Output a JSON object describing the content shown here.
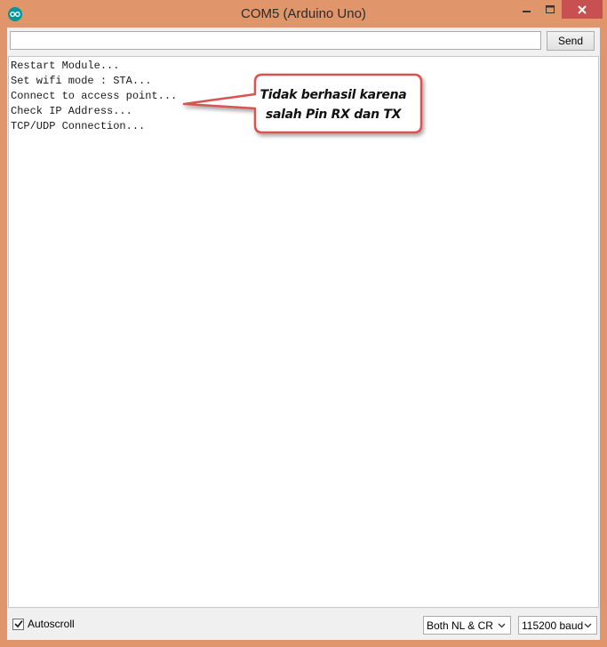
{
  "window": {
    "title": "COM5 (Arduino Uno)"
  },
  "input": {
    "value": "",
    "placeholder": ""
  },
  "send_button": {
    "label": "Send"
  },
  "output_lines": [
    "Restart Module...",
    "Set wifi mode : STA...",
    "Connect to access point...",
    "Check IP Address...",
    "TCP/UDP Connection..."
  ],
  "annotation": {
    "line1": "Tidak berhasil karena",
    "line2": "salah Pin RX dan TX"
  },
  "footer": {
    "autoscroll_label": "Autoscroll",
    "autoscroll_checked": true,
    "line_ending": "Both NL & CR",
    "baud_rate": "115200 baud"
  },
  "colors": {
    "window_frame": "#e0956b",
    "close_button": "#c75050",
    "annotation_border": "#d9534f",
    "app_icon": "#00979c"
  },
  "icons": {
    "app": "arduino-logo-icon",
    "minimize": "minimize-icon",
    "maximize": "maximize-icon",
    "close": "close-icon",
    "checkbox": "checkmark-icon",
    "dropdown": "chevron-down-icon"
  }
}
